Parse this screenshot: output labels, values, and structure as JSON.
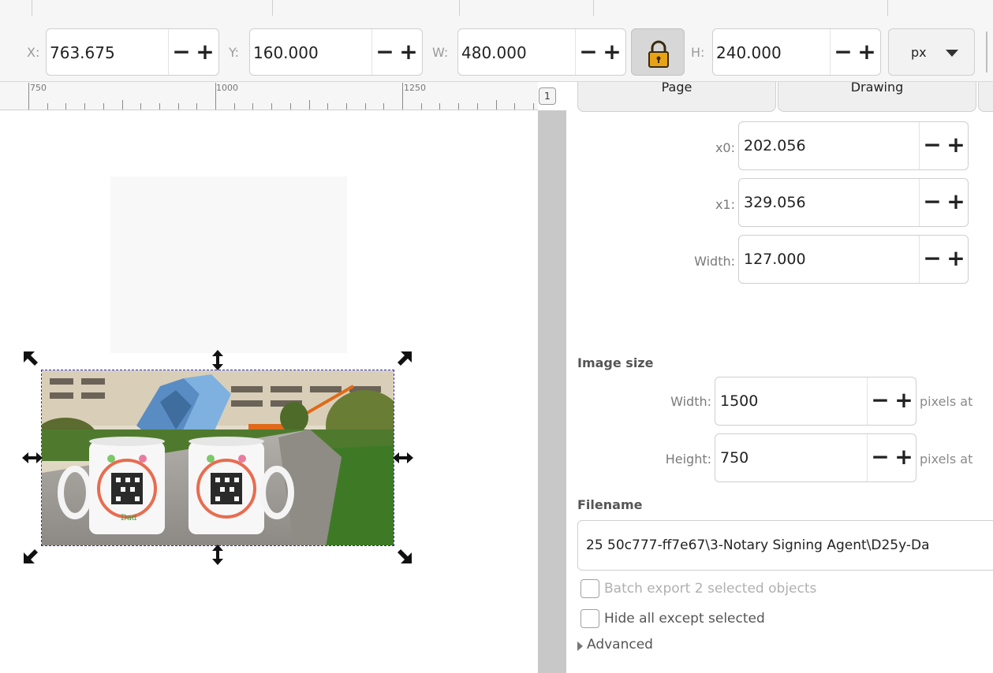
{
  "toolbar": {
    "x": {
      "label": "X:",
      "value": "763.675"
    },
    "y": {
      "label": "Y:",
      "value": "160.000"
    },
    "w": {
      "label": "W:",
      "value": "480.000"
    },
    "h": {
      "label": "H:",
      "value": "240.000"
    },
    "minus": "−",
    "plus": "+",
    "lock_icon": "padlock-icon",
    "unit": "px"
  },
  "ruler": {
    "labels": [
      "750",
      "1000",
      "1250"
    ],
    "corner_label": "1"
  },
  "canvas": {
    "image_icon": "photo-of-two-mugs-near-sculpture"
  },
  "panel": {
    "tabs": [
      "Page",
      "Drawing"
    ],
    "area": {
      "x0": {
        "label": "x0:",
        "value": "202.056"
      },
      "x1": {
        "label": "x1:",
        "value": "329.056"
      },
      "width": {
        "label": "Width:",
        "value": "127.000"
      }
    },
    "image_size": {
      "title": "Image size",
      "width": {
        "label": "Width:",
        "value": "1500",
        "suffix": "pixels at"
      },
      "height": {
        "label": "Height:",
        "value": "750",
        "suffix": "pixels at"
      }
    },
    "filename": {
      "title": "Filename",
      "value": "25 50c777-ff7e67\\3-Notary Signing Agent\\D25y-Da"
    },
    "batch_export": "Batch export 2 selected objects",
    "hide_all": "Hide all except selected",
    "advanced": "Advanced"
  },
  "colors": {
    "selection_dash": "#2b2bd0",
    "toolbar_bg": "#f6f6f6",
    "scrollbar": "#c8c8c8"
  }
}
